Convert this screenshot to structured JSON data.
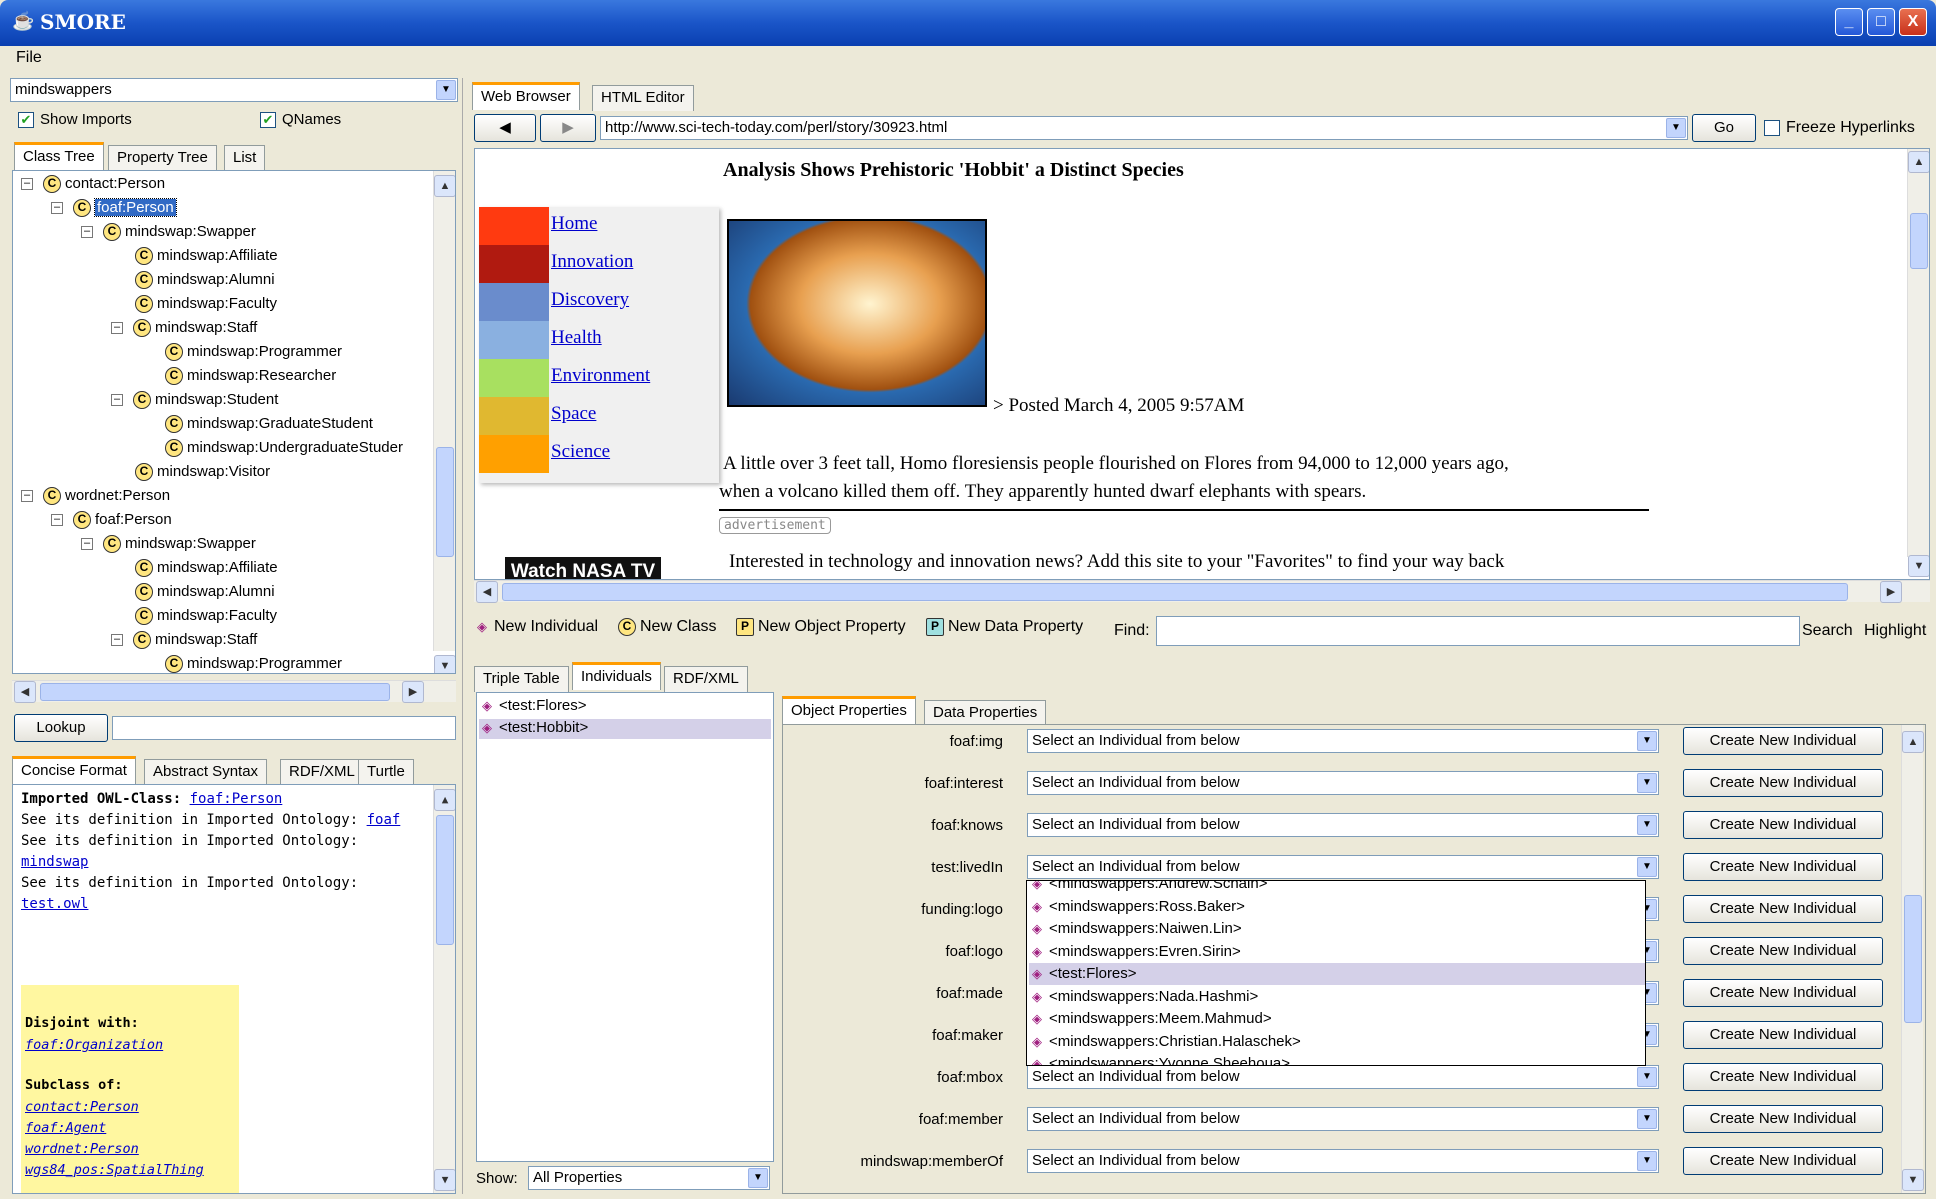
{
  "window": {
    "title": "SMORE",
    "min": "_",
    "max": "□",
    "close": "X"
  },
  "menu": {
    "file": "File"
  },
  "left": {
    "ontology_select": "mindswappers",
    "show_imports": "Show Imports",
    "qnames": "QNames",
    "tabs": [
      "Class Tree",
      "Property Tree",
      "List"
    ],
    "tree": [
      {
        "label": "contact:Person",
        "depth": 0,
        "exp": "⊟"
      },
      {
        "label": "foaf:Person",
        "depth": 1,
        "exp": "⊟",
        "selected": true
      },
      {
        "label": "mindswap:Swapper",
        "depth": 2,
        "exp": "⊟"
      },
      {
        "label": "mindswap:Affiliate",
        "depth": 3,
        "exp": ""
      },
      {
        "label": "mindswap:Alumni",
        "depth": 3,
        "exp": ""
      },
      {
        "label": "mindswap:Faculty",
        "depth": 3,
        "exp": ""
      },
      {
        "label": "mindswap:Staff",
        "depth": 3,
        "exp": "⊟"
      },
      {
        "label": "mindswap:Programmer",
        "depth": 4,
        "exp": ""
      },
      {
        "label": "mindswap:Researcher",
        "depth": 4,
        "exp": ""
      },
      {
        "label": "mindswap:Student",
        "depth": 3,
        "exp": "⊟"
      },
      {
        "label": "mindswap:GraduateStudent",
        "depth": 4,
        "exp": ""
      },
      {
        "label": "mindswap:UndergraduateStuder",
        "depth": 4,
        "exp": ""
      },
      {
        "label": "mindswap:Visitor",
        "depth": 3,
        "exp": ""
      },
      {
        "label": "wordnet:Person",
        "depth": 0,
        "exp": "⊟"
      },
      {
        "label": "foaf:Person",
        "depth": 1,
        "exp": "⊟"
      },
      {
        "label": "mindswap:Swapper",
        "depth": 2,
        "exp": "⊟"
      },
      {
        "label": "mindswap:Affiliate",
        "depth": 3,
        "exp": ""
      },
      {
        "label": "mindswap:Alumni",
        "depth": 3,
        "exp": ""
      },
      {
        "label": "mindswap:Faculty",
        "depth": 3,
        "exp": ""
      },
      {
        "label": "mindswap:Staff",
        "depth": 3,
        "exp": "⊟"
      },
      {
        "label": "mindswap:Programmer",
        "depth": 4,
        "exp": ""
      }
    ],
    "lookup": "Lookup",
    "format_tabs": [
      "Concise Format",
      "Abstract Syntax",
      "RDF/XML",
      "Turtle"
    ],
    "concise": {
      "imported_label": "Imported OWL-Class:",
      "imported_link": "foaf:Person",
      "def1": "See its definition in Imported Ontology:",
      "def1_link": "foaf",
      "def2": "See its definition in Imported Ontology:",
      "def2_link": "mindswap",
      "def3": "See its definition in Imported Ontology:",
      "def3_link": "test.owl",
      "disjoint_label": "Disjoint with:",
      "disjoint": [
        "foaf:Organization"
      ],
      "subclass_label": "Subclass of:",
      "subclass": [
        "contact:Person",
        "foaf:Agent",
        "wordnet:Person",
        "wgs84_pos:SpatialThing"
      ]
    }
  },
  "browser": {
    "tabs": [
      "Web Browser",
      "HTML Editor"
    ],
    "url": "http://www.sci-tech-today.com/perl/story/30923.html",
    "go": "Go",
    "freeze": "Freeze Hyperlinks",
    "headline": "Analysis Shows Prehistoric 'Hobbit' a Distinct Species",
    "posted": "> Posted March 4, 2005 9:57AM",
    "nav": [
      {
        "label": "Home",
        "color": "#ff3a10"
      },
      {
        "label": "Innovation",
        "color": "#b01a10"
      },
      {
        "label": "Discovery",
        "color": "#6a8ccc"
      },
      {
        "label": "Health",
        "color": "#8ab0e0"
      },
      {
        "label": "Environment",
        "color": "#a8e060"
      },
      {
        "label": "Space",
        "color": "#e0b830"
      },
      {
        "label": "Science",
        "color": "#ffa000"
      }
    ],
    "para1": "A little over 3 feet tall, Homo floresiensis people flourished on Flores from 94,000 to 12,000 years ago,",
    "para2": "when a volcano killed them off. They apparently hunted dwarf elephants with spears.",
    "ad": "advertisement",
    "para3": "Interested in technology and innovation news? Add this site to your \"Favorites\" to find your way back",
    "banner": "Watch NASA TV"
  },
  "toolbar": {
    "new_individual": "New Individual",
    "new_class": "New Class",
    "new_object_property": "New Object Property",
    "new_data_property": "New Data Property",
    "find": "Find:",
    "search": "Search",
    "highlight": "Highlight"
  },
  "bottom": {
    "tabs": [
      "Triple Table",
      "Individuals",
      "RDF/XML"
    ],
    "individuals": [
      "<test:Flores>",
      "<test:Hobbit>"
    ],
    "show_label": "Show:",
    "show_value": "All Properties",
    "prop_tabs": [
      "Object Properties",
      "Data Properties"
    ],
    "placeholder": "Select an Individual from below",
    "create": "Create New Individual",
    "props": [
      "foaf:img",
      "foaf:interest",
      "foaf:knows",
      "test:livedIn",
      "funding:logo",
      "foaf:logo",
      "foaf:made",
      "foaf:maker",
      "foaf:mbox",
      "foaf:member",
      "mindswap:memberOf"
    ],
    "dropdown": [
      "<mindswappers:Andrew.Schain>",
      "<mindswappers:Ross.Baker>",
      "<mindswappers:Naiwen.Lin>",
      "<mindswappers:Evren.Sirin>",
      "<test:Flores>",
      "<mindswappers:Nada.Hashmi>",
      "<mindswappers:Meem.Mahmud>",
      "<mindswappers:Christian.Halaschek>",
      "<mindswappers:Yvonne.Sheehoua>"
    ]
  }
}
